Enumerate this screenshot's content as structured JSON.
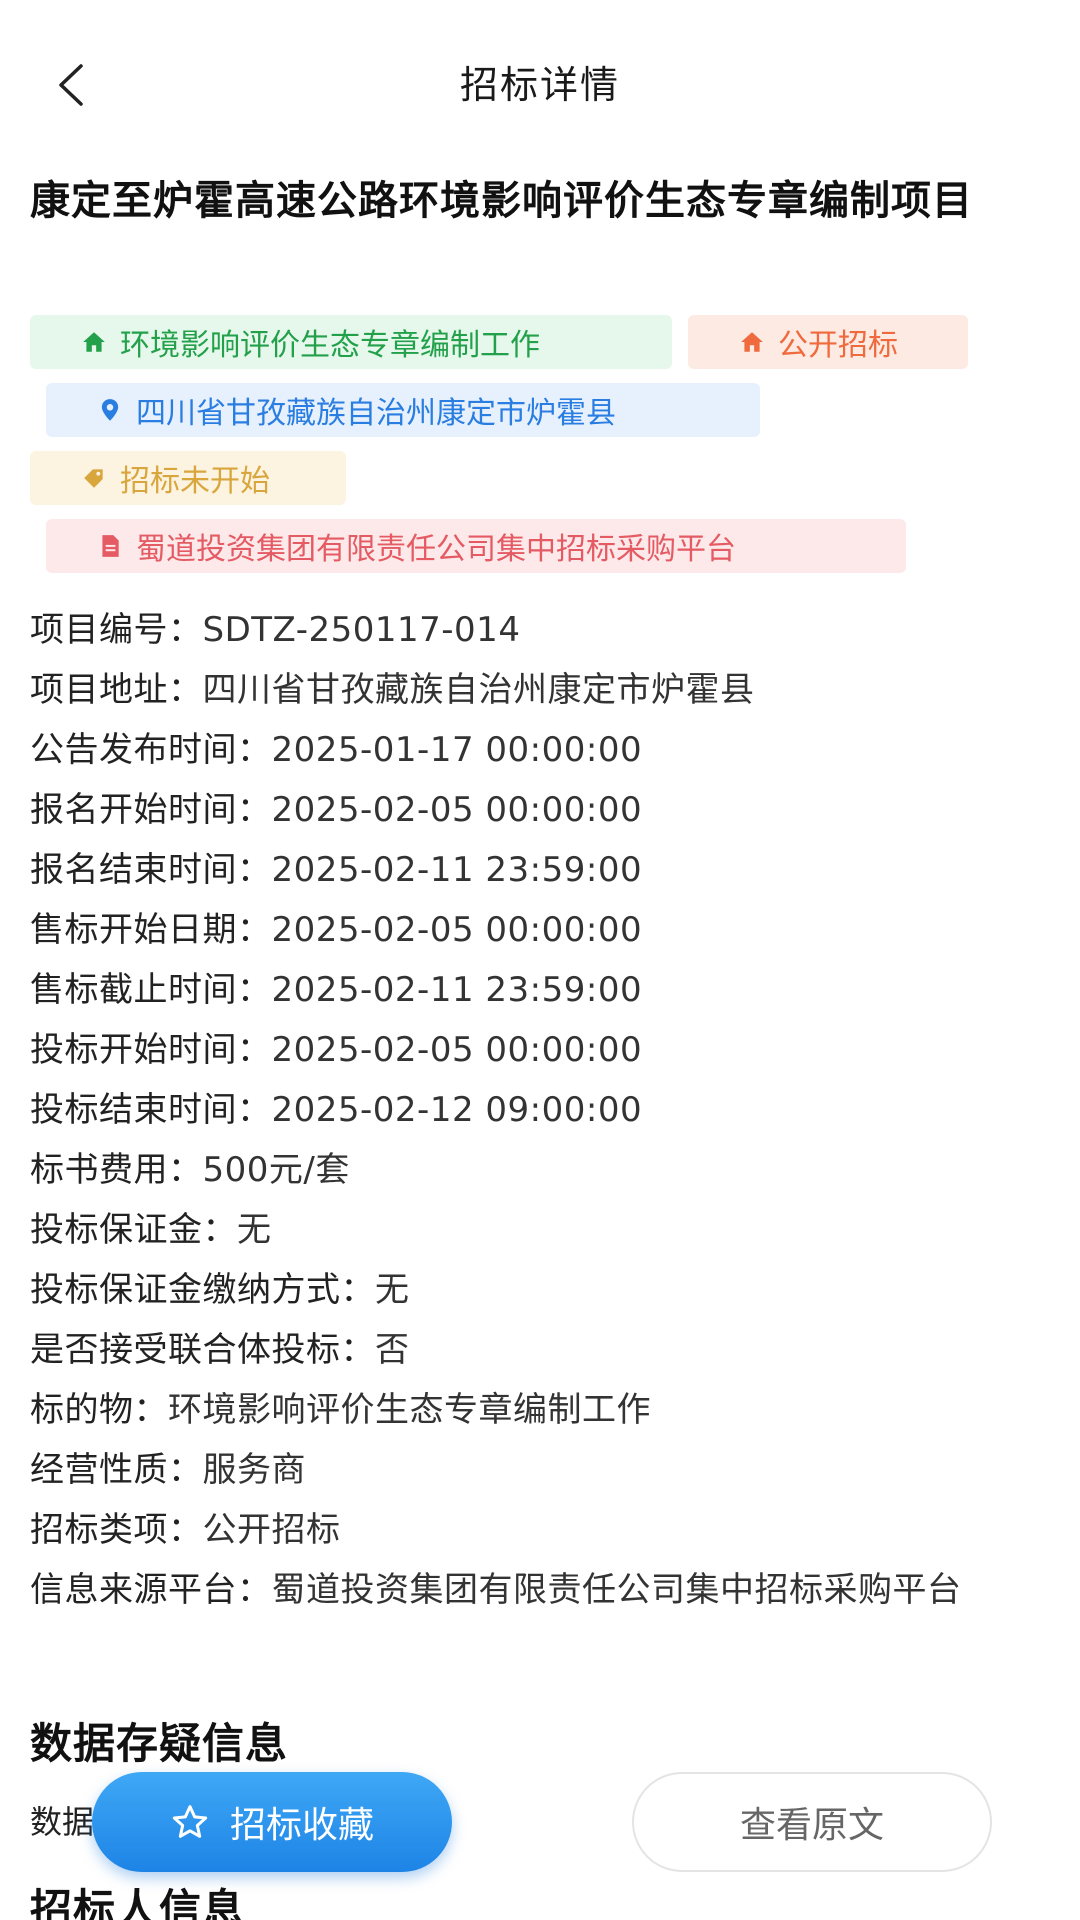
{
  "header": {
    "title": "招标详情",
    "back_icon": "chevron-left-icon"
  },
  "project": {
    "title": "康定至炉霍高速公路环境影响评价生态专章编制项目"
  },
  "tags": {
    "category": {
      "text": "环境影响评价生态专章编制工作",
      "icon": "home-icon",
      "color": "#22a14a",
      "bg": "#e6f7ec"
    },
    "type": {
      "text": "公开招标",
      "icon": "home-icon",
      "color": "#ef6a3c",
      "bg": "#fdeae3"
    },
    "location": {
      "text": "四川省甘孜藏族自治州康定市炉霍县",
      "icon": "location-pin-icon",
      "color": "#2a7de1",
      "bg": "#e6f1fd"
    },
    "status": {
      "text": "招标未开始",
      "icon": "tag-icon",
      "color": "#d8a63c",
      "bg": "#fcf3e1"
    },
    "platform": {
      "text": "蜀道投资集团有限责任公司集中招标采购平台",
      "icon": "document-icon",
      "color": "#e45b63",
      "bg": "#fde9ea"
    }
  },
  "info": [
    {
      "label": "项目编号：",
      "value": "SDTZ-250117-014"
    },
    {
      "label": "项目地址：",
      "value": "四川省甘孜藏族自治州康定市炉霍县"
    },
    {
      "label": "公告发布时间：",
      "value": "2025-01-17 00:00:00"
    },
    {
      "label": "报名开始时间：",
      "value": "2025-02-05 00:00:00"
    },
    {
      "label": "报名结束时间：",
      "value": "2025-02-11 23:59:00"
    },
    {
      "label": "售标开始日期：",
      "value": "2025-02-05 00:00:00"
    },
    {
      "label": "售标截止时间：",
      "value": "2025-02-11 23:59:00"
    },
    {
      "label": "投标开始时间：",
      "value": "2025-02-05 00:00:00"
    },
    {
      "label": "投标结束时间：",
      "value": "2025-02-12 09:00:00"
    },
    {
      "label": "标书费用：",
      "value": "500元/套"
    },
    {
      "label": "投标保证金：",
      "value": "无"
    },
    {
      "label": "投标保证金缴纳方式：",
      "value": "无"
    },
    {
      "label": "是否接受联合体投标：",
      "value": "否"
    },
    {
      "label": "标的物：",
      "value": "环境影响评价生态专章编制工作"
    },
    {
      "label": "经营性质：",
      "value": "服务商"
    },
    {
      "label": "招标类项：",
      "value": "公开招标"
    },
    {
      "label": "信息来源平台：",
      "value": "蜀道投资集团有限责任公司集中招标采购平台"
    }
  ],
  "sections": {
    "doubt_title": "数据存疑信息",
    "doubt_text": "数据",
    "bidder_title": "招标人信息"
  },
  "actions": {
    "favorite_label": "招标收藏",
    "favorite_icon": "star-outline-icon",
    "original_label": "查看原文"
  }
}
